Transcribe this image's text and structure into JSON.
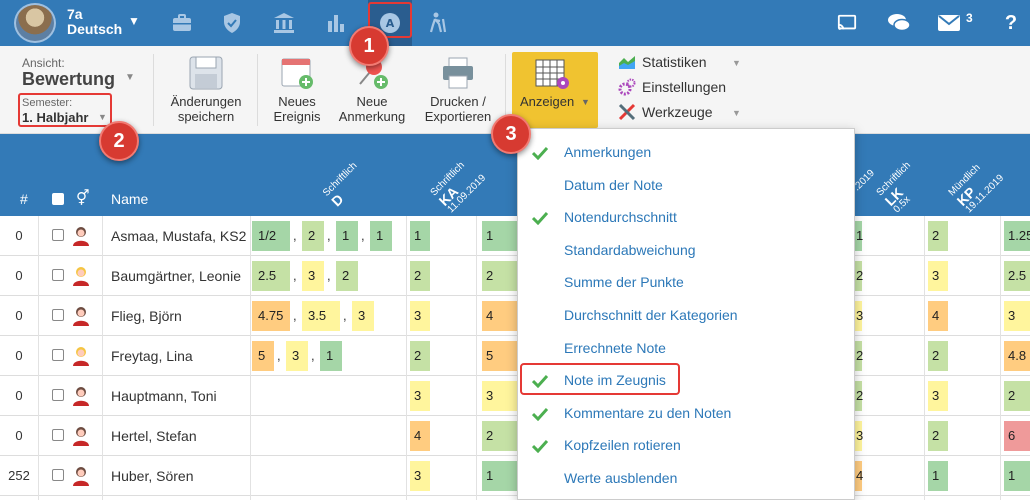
{
  "colors": {
    "primary": "#337ab7",
    "accent": "#f0c330",
    "annotation": "#e53935",
    "grade_green": "#a5d6a7",
    "grade_lightgreen": "#c5e1a5",
    "grade_yellow": "#fff59d",
    "grade_orange": "#ffcc80",
    "grade_red": "#ef9a9a"
  },
  "header": {
    "class_name": "7a",
    "subject": "Deutsch",
    "mail_count": "3",
    "icons": [
      "briefcase-icon",
      "shield-icon",
      "institution-icon",
      "bar-chart-icon",
      "grading-icon",
      "hiking-icon",
      "cast-icon",
      "chat-icon",
      "mail-icon",
      "help-icon"
    ]
  },
  "toolbar": {
    "view_label": "Ansicht:",
    "view_value": "Bewertung",
    "semester_label": "Semester:",
    "semester_value": "1. Halbjahr",
    "save": [
      "Änderungen",
      "speichern"
    ],
    "new_event": [
      "Neues",
      "Ereignis"
    ],
    "new_note": [
      "Neue",
      "Anmerkung"
    ],
    "print": [
      "Drucken /",
      "Exportieren"
    ],
    "show": "Anzeigen",
    "side": [
      "Statistiken",
      "Einstellungen",
      "Werkzeuge"
    ]
  },
  "table": {
    "col_num": "#",
    "col_name": "Name",
    "col_heads": [
      {
        "type": "Schriftlich",
        "code": "D",
        "date": ""
      },
      {
        "type": "Schriftlich",
        "code": "KA",
        "date": "11.09.2019"
      },
      {
        "type": "",
        "code": "",
        "date": ".2019"
      },
      {
        "type": "Schriftlich",
        "code": "LK",
        "date": "0.5x"
      },
      {
        "type": "Mündlich",
        "code": "KP",
        "date": "19.11.2019"
      }
    ],
    "rows": [
      {
        "num": "0",
        "name": "Asmaa, Mustafa, KS2",
        "avatar": "male",
        "grades": [
          "1/2",
          "2",
          "1",
          "1"
        ],
        "c1": "1",
        "c2": "1",
        "c3": "1",
        "c4": "2",
        "c5": "1.25"
      },
      {
        "num": "0",
        "name": "Baumgärtner, Leonie",
        "avatar": "female",
        "grades": [
          "2.5",
          "3",
          "2"
        ],
        "c1": "2",
        "c2": "2",
        "c3": "2",
        "c4": "3",
        "c5": "2.5"
      },
      {
        "num": "0",
        "name": "Flieg, Björn",
        "avatar": "male",
        "grades": [
          "4.75",
          "3.5",
          "3"
        ],
        "c1": "3",
        "c2": "4",
        "c3": "3",
        "c4": "4",
        "c5": "3"
      },
      {
        "num": "0",
        "name": "Freytag, Lina",
        "avatar": "female",
        "grades": [
          "5",
          "3",
          "1"
        ],
        "c1": "2",
        "c2": "5",
        "c3": "2",
        "c4": "2",
        "c5": "4.8"
      },
      {
        "num": "0",
        "name": "Hauptmann, Toni",
        "avatar": "male",
        "grades": [],
        "c1": "3",
        "c2": "3",
        "c3": "2",
        "c4": "3",
        "c5": "2"
      },
      {
        "num": "0",
        "name": "Hertel, Stefan",
        "avatar": "male",
        "grades": [],
        "c1": "4",
        "c2": "2",
        "c3": "3",
        "c4": "2",
        "c5": "6"
      },
      {
        "num": "252",
        "name": "Huber, Sören",
        "avatar": "male",
        "grades": [],
        "c1": "3",
        "c2": "1",
        "c3": "4",
        "c4": "1",
        "c5": "1"
      }
    ]
  },
  "dropdown": {
    "items": [
      {
        "label": "Anmerkungen",
        "checked": true
      },
      {
        "label": "Datum der Note",
        "checked": false
      },
      {
        "label": "Notendurchschnitt",
        "checked": true
      },
      {
        "label": "Standardabweichung",
        "checked": false
      },
      {
        "label": "Summe der Punkte",
        "checked": false
      },
      {
        "label": "Durchschnitt der Kategorien",
        "checked": false
      },
      {
        "label": "Errechnete Note",
        "checked": false
      },
      {
        "label": "Note im Zeugnis",
        "checked": true
      },
      {
        "label": "Kommentare zu den Noten",
        "checked": true
      },
      {
        "label": "Kopfzeilen rotieren",
        "checked": true
      },
      {
        "label": "Werte ausblenden",
        "checked": false
      }
    ]
  },
  "markers": [
    "1",
    "2",
    "3"
  ]
}
